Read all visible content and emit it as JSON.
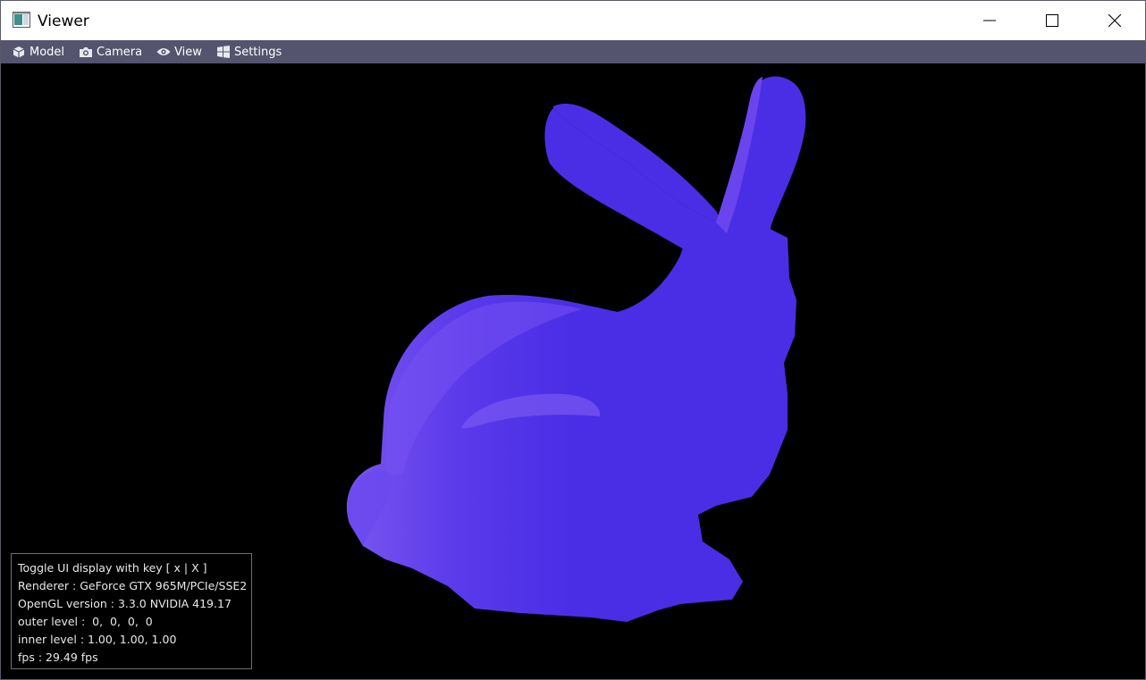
{
  "window": {
    "title": "Viewer",
    "controls": {
      "minimize_icon": "minimize-icon",
      "maximize_icon": "maximize-icon",
      "close_icon": "close-icon"
    }
  },
  "menubar": {
    "background": "#54546e",
    "items": [
      {
        "label": "Model",
        "icon": "cube-icon"
      },
      {
        "label": "Camera",
        "icon": "camera-icon"
      },
      {
        "label": "View",
        "icon": "eye-icon"
      },
      {
        "label": "Settings",
        "icon": "windows-icon"
      }
    ]
  },
  "viewport": {
    "background": "#000000",
    "model_color": "#4a2ee6",
    "highlight_color": "#7a55f0"
  },
  "overlay": {
    "lines": [
      "Toggle UI display with key [ x | X ]",
      "Renderer : GeForce GTX 965M/PCIe/SSE2",
      "OpenGL version : 3.3.0 NVIDIA 419.17",
      "outer level :  0,  0,  0,  0",
      "inner level : 1.00, 1.00, 1.00",
      "fps : 29.49 fps"
    ]
  }
}
